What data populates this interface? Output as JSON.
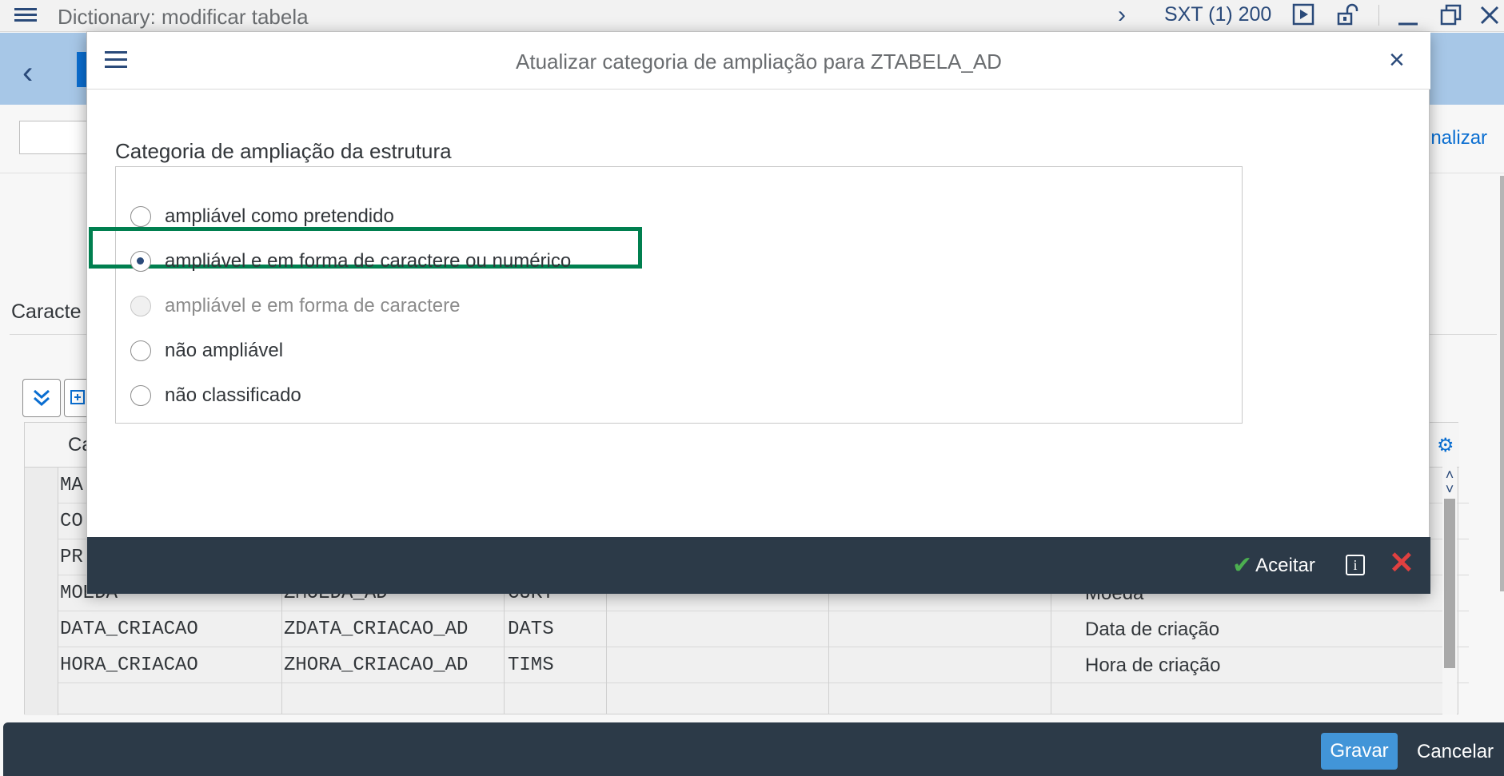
{
  "window": {
    "title": "Dictionary: modificar tabela",
    "system": "SXT (1) 200"
  },
  "toolbar": {
    "finalizar_label": "inalizar"
  },
  "tab": {
    "label": "Caracte"
  },
  "table": {
    "header_first": "Ca",
    "rows": [
      {
        "col1": "MA",
        "col2": "",
        "col3": "",
        "desc": ""
      },
      {
        "col1": "CO",
        "col2": "",
        "col3": "",
        "desc": ""
      },
      {
        "col1": "PR",
        "col2": "",
        "col3": "",
        "desc": ""
      },
      {
        "col1": "MOEDA",
        "col2": "ZMOEDA_AD",
        "col3": "CUKY",
        "desc": "Moeda"
      },
      {
        "col1": "DATA_CRIACAO",
        "col2": "ZDATA_CRIACAO_AD",
        "col3": "DATS",
        "desc": "Data de criação"
      },
      {
        "col1": "HORA_CRIACAO",
        "col2": "ZHORA_CRIACAO_AD",
        "col3": "TIMS",
        "desc": "Hora de criação"
      }
    ]
  },
  "footer": {
    "save_label": "Gravar",
    "cancel_label": "Cancelar"
  },
  "dialog": {
    "title": "Atualizar categoria de ampliação para ZTABELA_AD",
    "group_label": "Categoria de ampliação da estrutura",
    "options": [
      {
        "label": "ampliável como pretendido",
        "state": "unchecked"
      },
      {
        "label": "ampliável e em forma de caractere ou numérico",
        "state": "checked"
      },
      {
        "label": "ampliável e em forma de caractere",
        "state": "disabled"
      },
      {
        "label": "não ampliável",
        "state": "unchecked"
      },
      {
        "label": "não classificado",
        "state": "unchecked"
      }
    ],
    "accept_label": "Aceitar"
  },
  "colors": {
    "highlight": "#007f4f",
    "footer_bg": "#2c3a48",
    "shell_bg": "#a7c7e7",
    "primary_button": "#4295d8"
  }
}
